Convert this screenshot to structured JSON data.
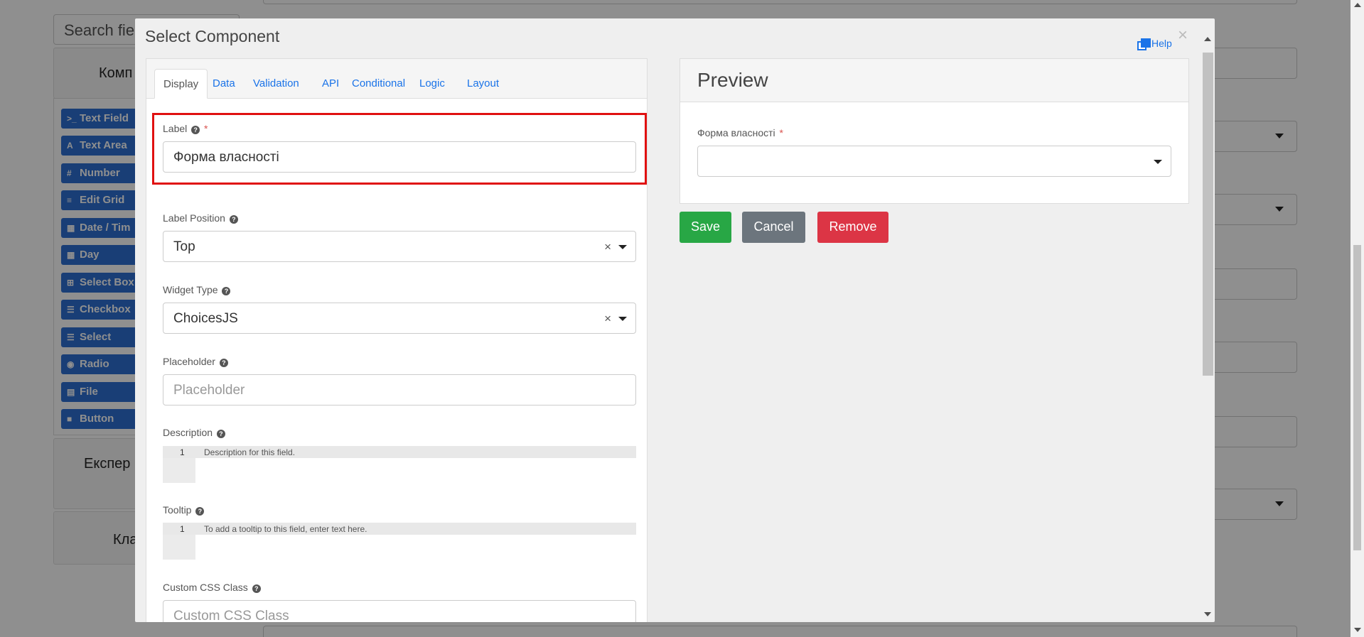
{
  "background": {
    "search_placeholder": "Search fie",
    "panels": [
      {
        "title": "Комп"
      },
      {
        "title": "Експер"
      },
      {
        "title": "Кла"
      }
    ],
    "components": [
      {
        "icon": ">_",
        "label": "Text Field"
      },
      {
        "icon": "A",
        "label": "Text Area"
      },
      {
        "icon": "#",
        "label": "Number"
      },
      {
        "icon": "≡",
        "label": "Edit Grid"
      },
      {
        "icon": "▦",
        "label": "Date / Tim"
      },
      {
        "icon": "▦",
        "label": "Day"
      },
      {
        "icon": "⊞",
        "label": "Select Box"
      },
      {
        "icon": "☰",
        "label": "Checkbox"
      },
      {
        "icon": "☰",
        "label": "Select"
      },
      {
        "icon": "◉",
        "label": "Radio"
      },
      {
        "icon": "▤",
        "label": "File"
      },
      {
        "icon": "■",
        "label": "Button"
      }
    ]
  },
  "modal": {
    "title": "Select Component",
    "help_label": "Help",
    "close_label": "×",
    "tabs": [
      {
        "label": "Display"
      },
      {
        "label": "Data"
      },
      {
        "label": "Validation"
      },
      {
        "label": "API"
      },
      {
        "label": "Conditional"
      },
      {
        "label": "Logic"
      },
      {
        "label": "Layout"
      }
    ],
    "fields": {
      "label": {
        "label": "Label",
        "value": "Форма власності",
        "required_mark": "*"
      },
      "label_position": {
        "label": "Label Position",
        "value": "Top",
        "clear": "×"
      },
      "widget_type": {
        "label": "Widget Type",
        "value": "ChoicesJS",
        "clear": "×"
      },
      "placeholder": {
        "label": "Placeholder",
        "placeholder": "Placeholder"
      },
      "description": {
        "label": "Description",
        "line_number": "1",
        "placeholder": "Description for this field."
      },
      "tooltip": {
        "label": "Tooltip",
        "line_number": "1",
        "placeholder": "To add a tooltip to this field, enter text here."
      },
      "custom_css": {
        "label": "Custom CSS Class",
        "placeholder": "Custom CSS Class"
      }
    },
    "help_glyph": "?",
    "preview": {
      "title": "Preview",
      "field_label": "Форма власності",
      "required_mark": "*"
    },
    "buttons": {
      "save": "Save",
      "cancel": "Cancel",
      "remove": "Remove"
    }
  },
  "colors": {
    "accent": "#1a73e8",
    "save": "#28a745",
    "cancel": "#6c757d",
    "remove": "#dc3545",
    "highlight": "#e01010",
    "component_button": "#2d6fd3"
  }
}
